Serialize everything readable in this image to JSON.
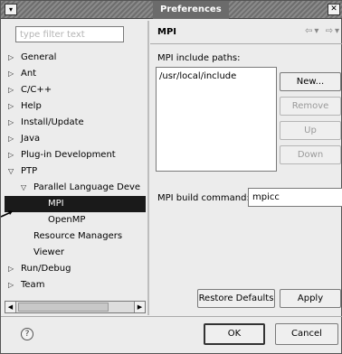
{
  "window": {
    "title": "Preferences",
    "menu_glyph": "▾",
    "close_glyph": "✕"
  },
  "filter": {
    "placeholder": "type filter text"
  },
  "tree": [
    {
      "label": "General",
      "expander": "▷",
      "level": 0
    },
    {
      "label": "Ant",
      "expander": "▷",
      "level": 0
    },
    {
      "label": "C/C++",
      "expander": "▷",
      "level": 0
    },
    {
      "label": "Help",
      "expander": "▷",
      "level": 0
    },
    {
      "label": "Install/Update",
      "expander": "▷",
      "level": 0
    },
    {
      "label": "Java",
      "expander": "▷",
      "level": 0
    },
    {
      "label": "Plug-in Development",
      "expander": "▷",
      "level": 0
    },
    {
      "label": "PTP",
      "expander": "▽",
      "level": 0
    },
    {
      "label": "Parallel Language Deve",
      "expander": "▽",
      "level": 1
    },
    {
      "label": "MPI",
      "expander": "",
      "level": 2,
      "selected": true
    },
    {
      "label": "OpenMP",
      "expander": "",
      "level": 2
    },
    {
      "label": "Resource Managers",
      "expander": "",
      "level": 1
    },
    {
      "label": "Viewer",
      "expander": "",
      "level": 1
    },
    {
      "label": "Run/Debug",
      "expander": "▷",
      "level": 0
    },
    {
      "label": "Team",
      "expander": "▷",
      "level": 0
    }
  ],
  "page": {
    "title": "MPI",
    "nav": "⇦▾ ⇨▾",
    "include_label": "MPI include paths:",
    "include_paths": [
      "/usr/local/include"
    ],
    "buttons": {
      "new": "New...",
      "remove": "Remove",
      "up": "Up",
      "down": "Down",
      "restore": "Restore Defaults",
      "apply": "Apply"
    },
    "build_label": "MPI build command:",
    "build_value": "mpicc"
  },
  "footer": {
    "help_glyph": "?",
    "ok": "OK",
    "cancel": "Cancel"
  }
}
